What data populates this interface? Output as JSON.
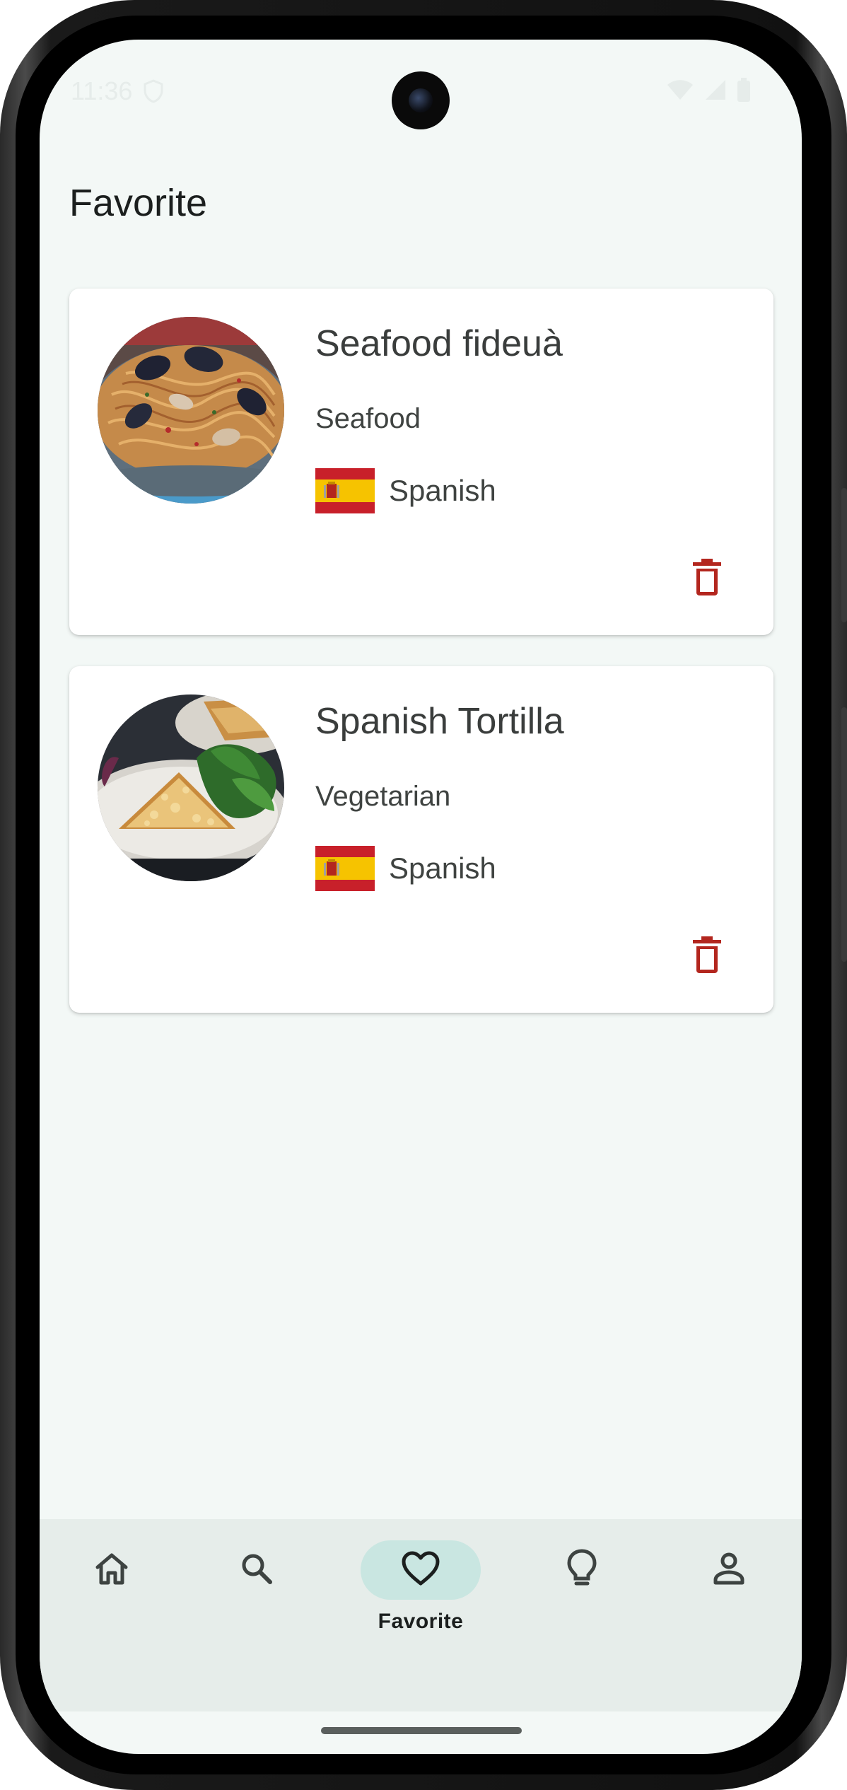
{
  "status_bar": {
    "time": "11:36"
  },
  "page": {
    "title": "Favorite"
  },
  "favorites": [
    {
      "name": "Seafood fideuà",
      "category": "Seafood",
      "cuisine": "Spanish",
      "flag_icon": "spain-flag-icon",
      "photo_icon": "seafood-noodles-photo"
    },
    {
      "name": "Spanish Tortilla",
      "category": "Vegetarian",
      "cuisine": "Spanish",
      "flag_icon": "spain-flag-icon",
      "photo_icon": "tortilla-photo"
    }
  ],
  "bottom_nav": {
    "items": [
      {
        "id": "home",
        "icon": "home-icon",
        "label": ""
      },
      {
        "id": "search",
        "icon": "search-icon",
        "label": ""
      },
      {
        "id": "favorite",
        "icon": "heart-icon",
        "label": "Favorite",
        "active": true
      },
      {
        "id": "ideas",
        "icon": "lightbulb-icon",
        "label": ""
      },
      {
        "id": "profile",
        "icon": "person-icon",
        "label": ""
      }
    ]
  },
  "colors": {
    "background": "#f3f8f6",
    "card": "#ffffff",
    "delete_red": "#b3261e",
    "nav_background": "#e6edea",
    "active_pill": "#c9e6e1"
  }
}
